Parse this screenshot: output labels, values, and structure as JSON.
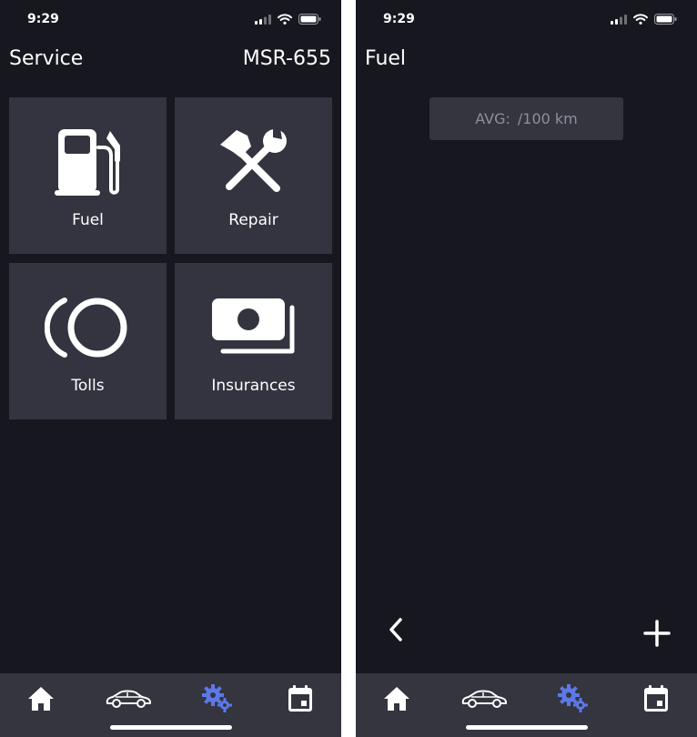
{
  "theme": {
    "background": "#17171f",
    "tile": "#33343f",
    "tab_bar": "#34353f",
    "accent": "#5d78e8",
    "muted_text": "#8e8f99"
  },
  "status_bar": {
    "time": "9:29",
    "icons": [
      "cellular-signal-icon",
      "wifi-icon",
      "battery-icon"
    ]
  },
  "service_screen": {
    "title": "Service",
    "plate": "MSR-655",
    "tiles": [
      {
        "label": "Fuel",
        "icon": "fuel-pump-icon"
      },
      {
        "label": "Repair",
        "icon": "wrench-hammer-icon"
      },
      {
        "label": "Tolls",
        "icon": "toll-coins-icon"
      },
      {
        "label": "Insurances",
        "icon": "banknotes-icon"
      }
    ]
  },
  "fuel_screen": {
    "title": "Fuel",
    "avg_label": "AVG:",
    "avg_unit": "/100 km",
    "back_icon": "chevron-left-icon",
    "add_icon": "plus-icon"
  },
  "tab_bar": {
    "items": [
      {
        "icon": "home-icon",
        "active": false
      },
      {
        "icon": "car-icon",
        "active": false
      },
      {
        "icon": "gears-icon",
        "active": true
      },
      {
        "icon": "calendar-icon",
        "active": false
      }
    ]
  }
}
